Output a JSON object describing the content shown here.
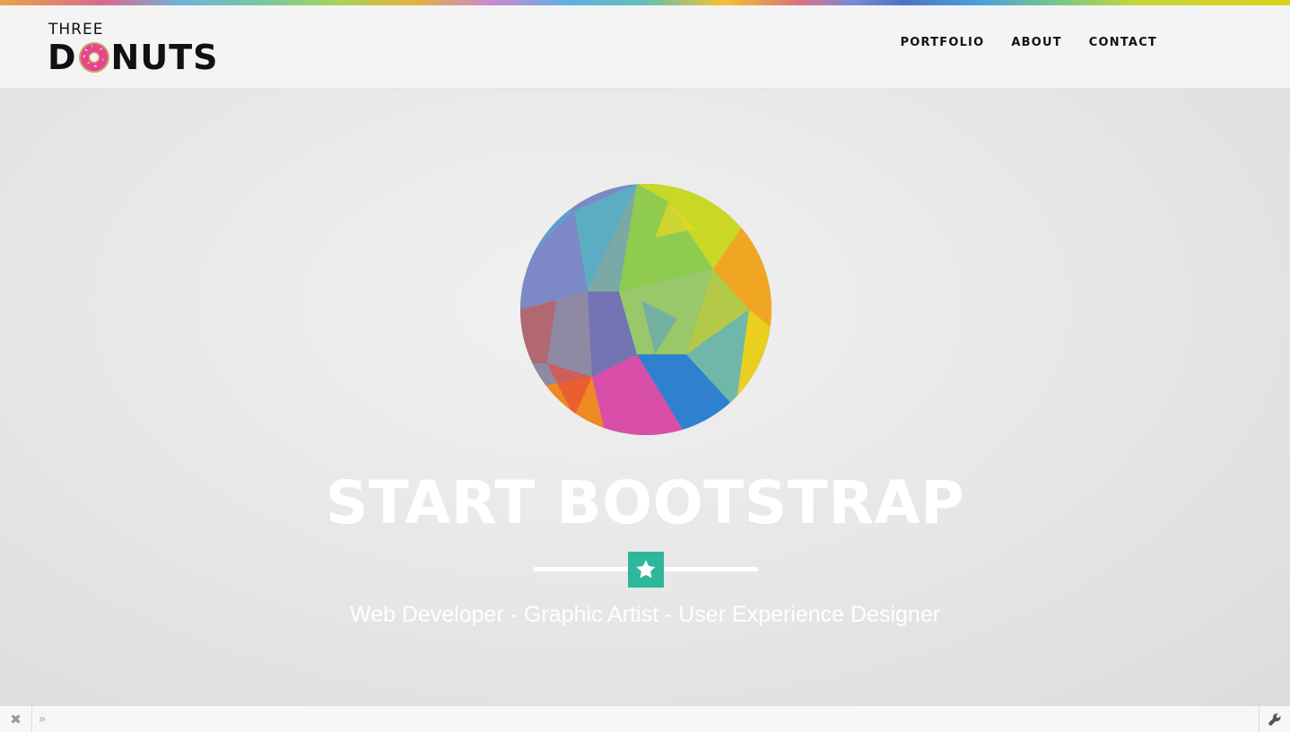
{
  "logo": {
    "top_word": "THREE",
    "d_letter": "D",
    "rest_letters": "NUTS",
    "donut_icon": "pink-donut-icon"
  },
  "nav": {
    "items": [
      {
        "label": "PORTFOLIO"
      },
      {
        "label": "ABOUT"
      },
      {
        "label": "CONTACT"
      }
    ]
  },
  "hero": {
    "title": "START BOOTSTRAP",
    "subtitle": "Web Developer - Graphic Artist - User Experience Designer",
    "star_icon": "star-icon",
    "accent_color": "#2fb79c",
    "image": "geometric-rainbow-circle"
  },
  "bottom_bar": {
    "close_icon": "close-icon",
    "close_glyph": "✖",
    "expand_icon": "double-chevron-right-icon",
    "expand_glyph": "»",
    "settings_icon": "wrench-icon"
  }
}
